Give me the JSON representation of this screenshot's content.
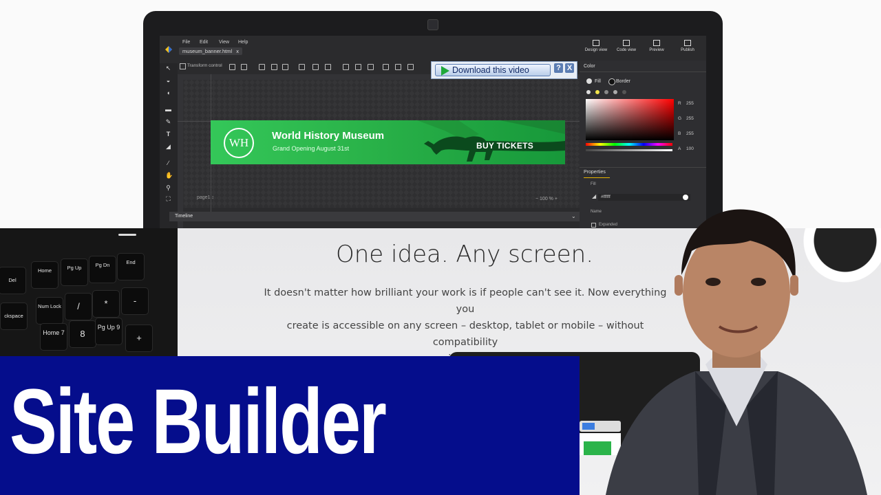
{
  "app": {
    "menus": [
      "File",
      "Edit",
      "View",
      "Help"
    ],
    "file_tab": "museum_banner.html",
    "file_tab_close": "x",
    "actions": [
      "Design view",
      "Code view",
      "Preview",
      "Publish"
    ],
    "transform_control": "Transform control"
  },
  "banner": {
    "logo": "WH",
    "title": "World History Museum",
    "subtitle": "Grand Opening  August 31st",
    "cta": "BUY TICKETS"
  },
  "canvas": {
    "page_label": "page1 ↕",
    "zoom": "−   100 %  +",
    "timeline": "Timeline"
  },
  "color_panel": {
    "title": "Color",
    "fill_tab": "Fill",
    "border_tab": "Border",
    "r_label": "R",
    "r_value": "255",
    "g_label": "G",
    "g_value": "255",
    "b_label": "B",
    "b_value": "255",
    "a_label": "A",
    "a_value": "100"
  },
  "properties_panel": {
    "title": "Properties",
    "fill_label": "Fill",
    "fill_value": "#ffffff",
    "name_label": "Name",
    "expanded_label": "Expanded"
  },
  "download_bar": {
    "button": "Download this video",
    "help": "?",
    "close": "X"
  },
  "keyboard": {
    "keys": [
      "Del",
      "Home",
      "Pg Up",
      "Pg Dn",
      "End",
      "Num Lock",
      "/",
      "*",
      "-",
      "Home 7",
      "8",
      "Pg Up 9",
      "+",
      "ckspace"
    ]
  },
  "marketing": {
    "headline": "One idea. Any screen.",
    "body_line1": "It doesn't matter how brilliant your work is if people can't see it. Now everything you",
    "body_line2": "create is accessible on any screen – desktop, tablet or mobile – without compatibility",
    "body_line3": "issues."
  },
  "thumbnail_title": "Site Builder",
  "colors": {
    "title_band": "#050d8c",
    "banner_green": "#2bb44a",
    "download_play": "#1fa83a"
  }
}
